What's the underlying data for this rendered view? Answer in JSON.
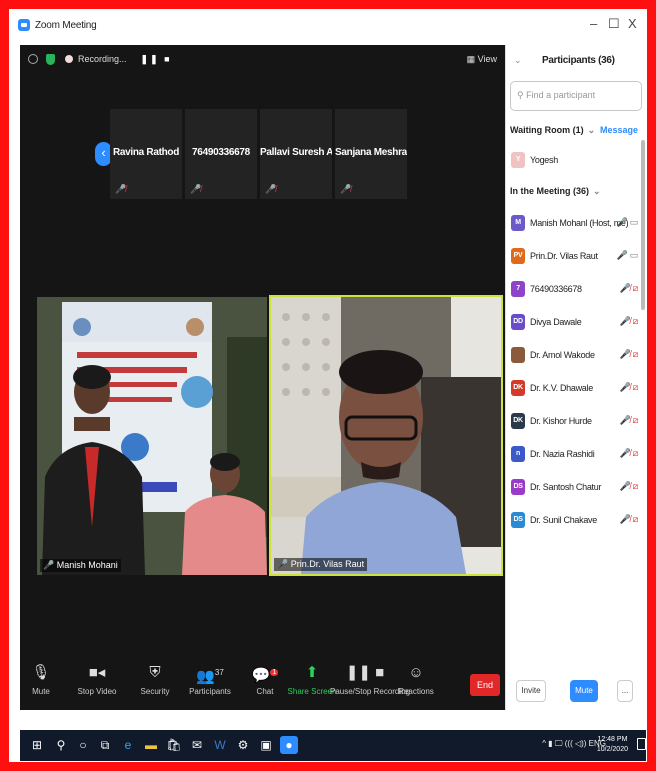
{
  "window": {
    "title": "Zoom Meeting",
    "minimize": "–",
    "maximize": "☐",
    "close": "X"
  },
  "topbar": {
    "recording": "Recording...",
    "pause": "❚❚ ■",
    "view": "View"
  },
  "strip": [
    {
      "name": "Ravina Rathod"
    },
    {
      "name": "76490336678"
    },
    {
      "name": "Pallavi Suresh A..."
    },
    {
      "name": "Sanjana Meshram"
    }
  ],
  "videos": [
    {
      "name": "Manish Mohani"
    },
    {
      "name": "Prin.Dr. Vilas Raut"
    }
  ],
  "toolbar": {
    "mute": "Mute",
    "stop_video": "Stop Video",
    "security": "Security",
    "participants": "Participants",
    "participants_count": "37",
    "chat": "Chat",
    "chat_badge": "1",
    "share": "Share Screen",
    "recording": "Pause/Stop Recording",
    "reactions": "Reactions",
    "end": "End"
  },
  "panel": {
    "title": "Participants (36)",
    "search_placeholder": "Find a participant",
    "waiting_room": "Waiting Room (1)",
    "message": "Message",
    "waiting": [
      {
        "name": "Yogesh",
        "initial": "Y",
        "color": "#f0c2c2"
      }
    ],
    "in_meeting": "In the Meeting (36)",
    "participants": [
      {
        "name": "Manish Mohanl (Host, me)",
        "initial": "M",
        "color": "#6a5bc9",
        "muted": false
      },
      {
        "name": "Prin.Dr. Vilas Raut",
        "initial": "PV",
        "color": "#e06a1a",
        "muted": false
      },
      {
        "name": "76490336678",
        "initial": "7",
        "color": "#8e44c9",
        "muted": true
      },
      {
        "name": "Divya Dawale",
        "initial": "DD",
        "color": "#6a4bc9",
        "muted": true
      },
      {
        "name": "Dr. Amol Wakode",
        "initial": "",
        "color": "#8a5a3a",
        "muted": true
      },
      {
        "name": "Dr. K.V. Dhawale",
        "initial": "DK",
        "color": "#d43a2a",
        "muted": true
      },
      {
        "name": "Dr. Kishor Hurde",
        "initial": "DK",
        "color": "#2a3a4a",
        "muted": true
      },
      {
        "name": "Dr. Nazia Rashidi",
        "initial": "n",
        "color": "#3a5ac9",
        "muted": true
      },
      {
        "name": "Dr. Santosh Chatur",
        "initial": "DS",
        "color": "#9a3ac9",
        "muted": true
      },
      {
        "name": "Dr. Sunil Chakave",
        "initial": "DS",
        "color": "#2a8ad4",
        "muted": true
      }
    ],
    "invite": "Invite",
    "mute_all": "Mute All",
    "more": "..."
  },
  "taskbar": {
    "tray": "^ ▮ 🖵 ((( ◁)) ENG",
    "time": "12:48 PM",
    "date": "10/2/2020"
  }
}
